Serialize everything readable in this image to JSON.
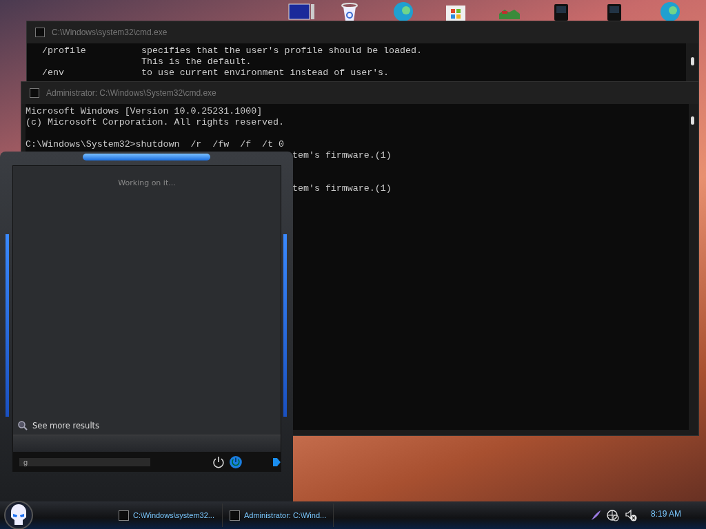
{
  "desktop": {
    "icons": [
      {
        "kind": "monitor"
      },
      {
        "kind": "recycle"
      },
      {
        "kind": "browser"
      },
      {
        "kind": "store"
      },
      {
        "kind": "app"
      },
      {
        "kind": "device"
      },
      {
        "kind": "device"
      },
      {
        "kind": "browser"
      }
    ]
  },
  "back_window": {
    "title": "C:\\Windows\\system32\\cmd.exe",
    "lines": [
      {
        "option": "/profile",
        "text": "specifies that the user's profile should be loaded."
      },
      {
        "text": "This is the default."
      },
      {
        "option": "/env",
        "text": "to use current environment instead of user's."
      }
    ]
  },
  "front_window": {
    "title": "Administrator: C:\\Windows\\System32\\cmd.exe",
    "lines": [
      {
        "kind": "full",
        "text": "Microsoft Windows [Version 10.0.25231.1000]"
      },
      {
        "kind": "full",
        "text": "(c) Microsoft Corporation. All rights reserved."
      },
      {
        "kind": "blank"
      },
      {
        "kind": "full",
        "text": "C:\\Windows\\System32>shutdown  /r  /fw  /f  /t 0"
      },
      {
        "kind": "partial",
        "text": "tem's firmware.(1)"
      },
      {
        "kind": "blank"
      },
      {
        "kind": "blank"
      },
      {
        "kind": "partial",
        "text": "tem's firmware.(1)"
      }
    ]
  },
  "start_menu": {
    "status": "Working on it...",
    "more_results": "See more results",
    "search": {
      "value": "g"
    }
  },
  "taskbar": {
    "tasks": [
      {
        "label": "C:\\Windows\\system32..."
      },
      {
        "label": "Administrator: C:\\Wind..."
      }
    ],
    "clock": "8:19 AM"
  }
}
